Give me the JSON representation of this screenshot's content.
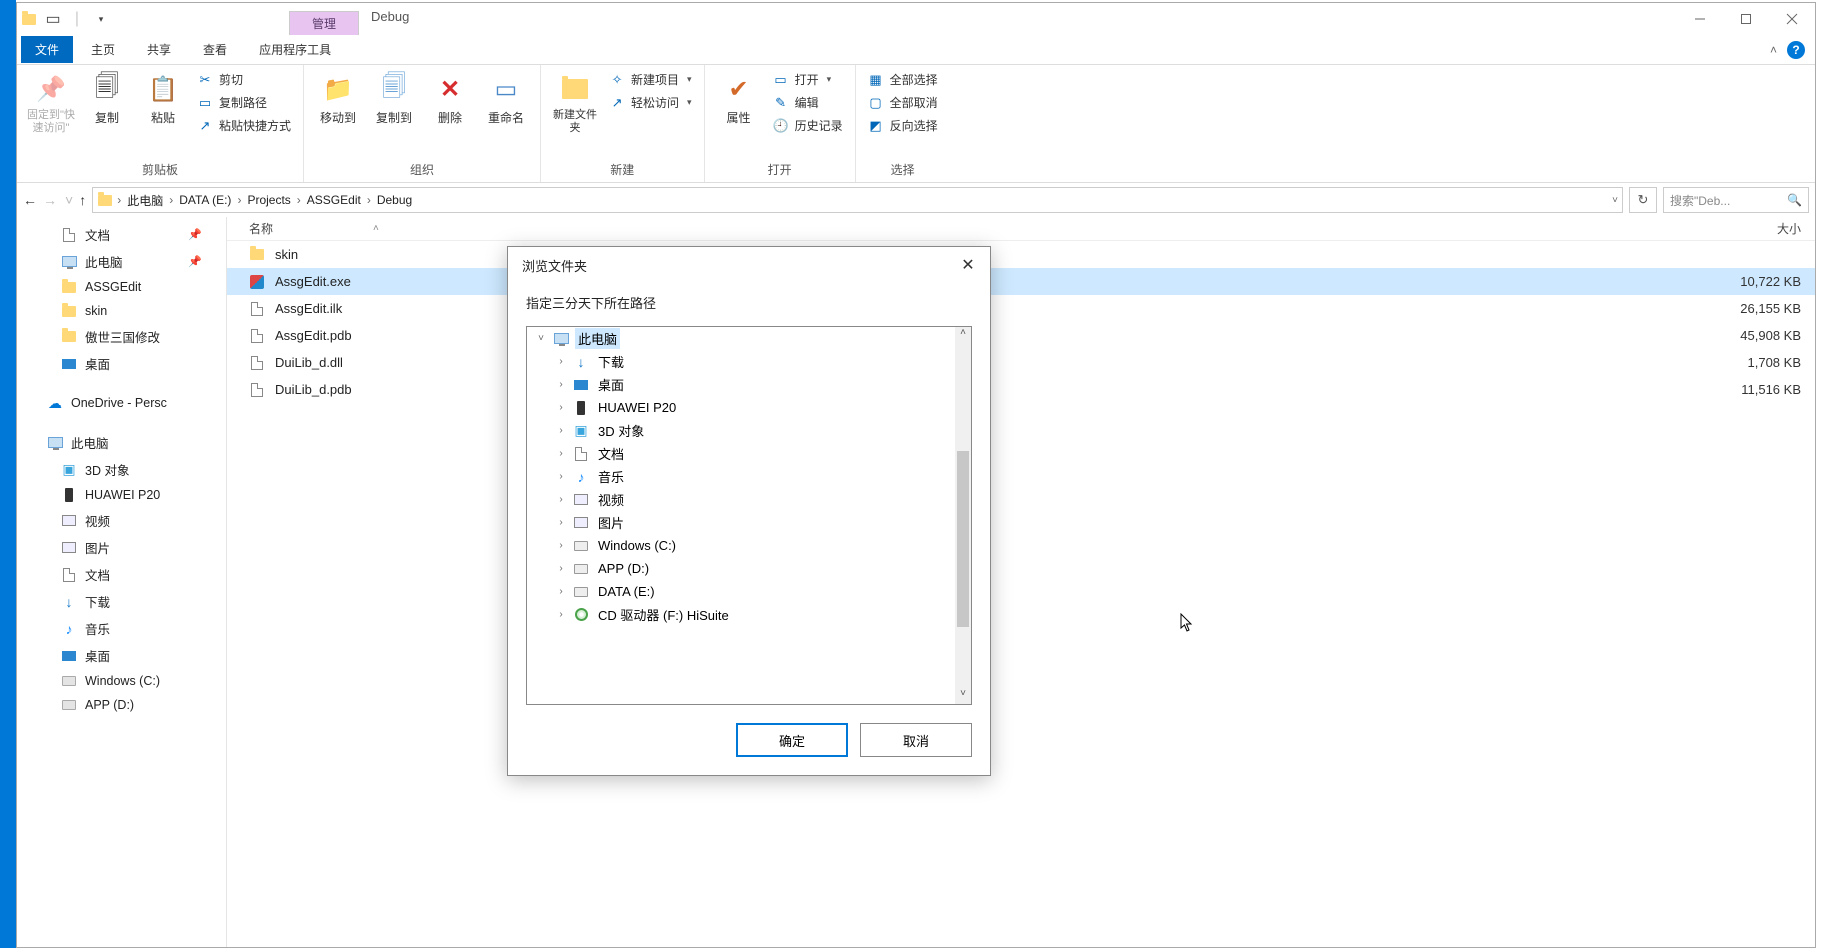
{
  "window": {
    "contextual_tab": "管理",
    "title": "Debug"
  },
  "ribbon_tabs": {
    "file": "文件",
    "home": "主页",
    "share": "共享",
    "view": "查看",
    "tools": "应用程序工具"
  },
  "ribbon": {
    "clipboard": {
      "label": "剪贴板",
      "pin": "固定到\"快速访问\"",
      "copy": "复制",
      "paste": "粘贴",
      "cut": "剪切",
      "copy_path": "复制路径",
      "paste_shortcut": "粘贴快捷方式"
    },
    "organize": {
      "label": "组织",
      "move_to": "移动到",
      "copy_to": "复制到",
      "delete": "删除",
      "rename": "重命名"
    },
    "new": {
      "label": "新建",
      "new_folder": "新建文件夹",
      "new_item": "新建项目",
      "easy_access": "轻松访问"
    },
    "open": {
      "label": "打开",
      "properties": "属性",
      "open": "打开",
      "edit": "编辑",
      "history": "历史记录"
    },
    "select": {
      "label": "选择",
      "select_all": "全部选择",
      "select_none": "全部取消",
      "invert": "反向选择"
    }
  },
  "breadcrumb": {
    "items": [
      "此电脑",
      "DATA (E:)",
      "Projects",
      "ASSGEdit",
      "Debug"
    ]
  },
  "search": {
    "placeholder": "搜索\"Deb..."
  },
  "side_nav": {
    "documents": "文档",
    "this_pc_pinned": "此电脑",
    "assgedit": "ASSGEdit",
    "skin": "skin",
    "aoshi": "傲世三国修改",
    "desktop_pinned": "桌面",
    "onedrive": "OneDrive - Persc",
    "this_pc": "此电脑",
    "objects3d": "3D 对象",
    "huawei": "HUAWEI P20",
    "videos": "视频",
    "pictures": "图片",
    "documents2": "文档",
    "downloads": "下载",
    "music": "音乐",
    "desktop": "桌面",
    "windows_c": "Windows (C:)",
    "app_d": "APP (D:)"
  },
  "columns": {
    "name": "名称",
    "size": "大小"
  },
  "files": [
    {
      "name": "skin",
      "type": "folder",
      "size": ""
    },
    {
      "name": "AssgEdit.exe",
      "type": "exe",
      "size": "10,722 KB",
      "selected": true
    },
    {
      "name": "AssgEdit.ilk",
      "type": "doc",
      "size": "26,155 KB"
    },
    {
      "name": "AssgEdit.pdb",
      "type": "doc",
      "size": "45,908 KB"
    },
    {
      "name": "DuiLib_d.dll",
      "type": "doc",
      "size": "1,708 KB"
    },
    {
      "name": "DuiLib_d.pdb",
      "type": "doc",
      "size": "11,516 KB"
    }
  ],
  "dialog": {
    "title": "浏览文件夹",
    "message": "指定三分天下所在路径",
    "ok": "确定",
    "cancel": "取消",
    "tree": {
      "root": "此电脑",
      "items": [
        {
          "label": "下载",
          "icon": "download"
        },
        {
          "label": "桌面",
          "icon": "desktop"
        },
        {
          "label": "HUAWEI P20",
          "icon": "phone"
        },
        {
          "label": "3D 对象",
          "icon": "3d"
        },
        {
          "label": "文档",
          "icon": "doc"
        },
        {
          "label": "音乐",
          "icon": "music"
        },
        {
          "label": "视频",
          "icon": "video"
        },
        {
          "label": "图片",
          "icon": "picture"
        },
        {
          "label": "Windows (C:)",
          "icon": "drive"
        },
        {
          "label": "APP (D:)",
          "icon": "drive"
        },
        {
          "label": "DATA (E:)",
          "icon": "drive"
        },
        {
          "label": "CD 驱动器 (F:) HiSuite",
          "icon": "cd"
        }
      ]
    }
  }
}
